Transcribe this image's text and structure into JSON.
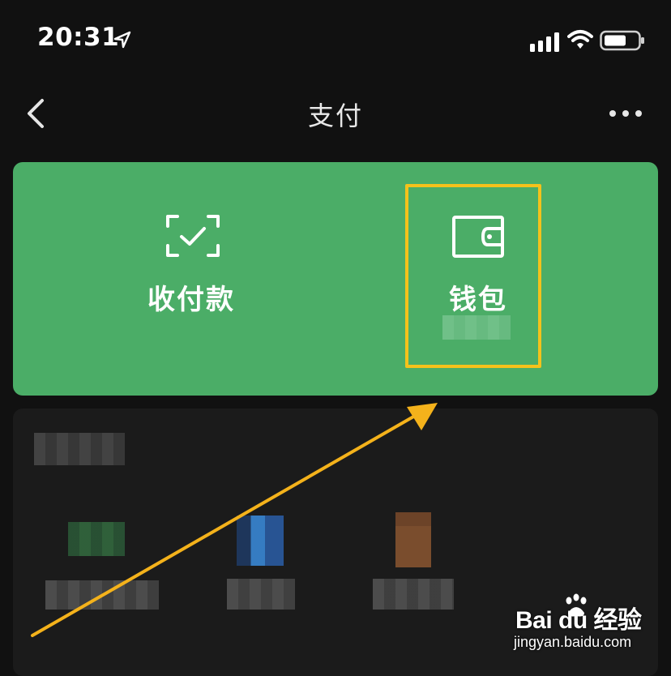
{
  "status_bar": {
    "time": "20:31",
    "icons": [
      "location-arrow-icon",
      "signal-icon",
      "wifi-icon",
      "battery-icon"
    ]
  },
  "nav": {
    "title": "支付",
    "back_icon": "chevron-left-icon",
    "more_icon": "more-dots-icon"
  },
  "card": {
    "background": "#4bad67",
    "actions": [
      {
        "label": "收付款",
        "icon": "scan-check-icon"
      },
      {
        "label": "钱包",
        "icon": "wallet-icon"
      }
    ],
    "highlight_color": "#f4c21b"
  },
  "annotation": {
    "arrow_color": "#f4b21b"
  },
  "watermark": {
    "logo_text": "Bai du 经验",
    "url": "jingyan.baidu.com"
  }
}
